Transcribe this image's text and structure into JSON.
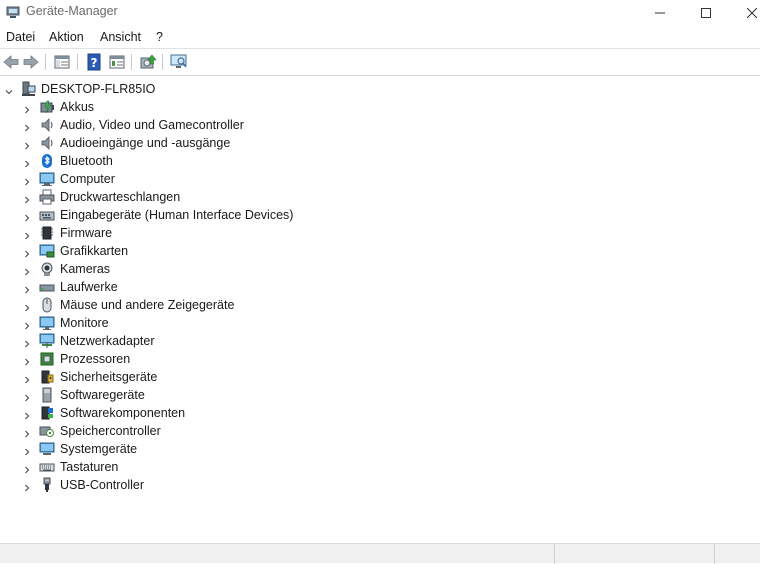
{
  "window": {
    "title": "Geräte-Manager"
  },
  "menu": {
    "items": [
      "Datei",
      "Aktion",
      "Ansicht",
      "?"
    ]
  },
  "tree": {
    "root_label": "DESKTOP-FLR85IO",
    "categories": [
      {
        "label": "Akkus",
        "icon": "battery-icon"
      },
      {
        "label": "Audio, Video und Gamecontroller",
        "icon": "speaker-icon"
      },
      {
        "label": "Audioeingänge und -ausgänge",
        "icon": "speaker-icon"
      },
      {
        "label": "Bluetooth",
        "icon": "bluetooth-icon"
      },
      {
        "label": "Computer",
        "icon": "computer-icon"
      },
      {
        "label": "Druckwarteschlangen",
        "icon": "printer-icon"
      },
      {
        "label": "Eingabegeräte (Human Interface Devices)",
        "icon": "hid-icon"
      },
      {
        "label": "Firmware",
        "icon": "firmware-icon"
      },
      {
        "label": "Grafikkarten",
        "icon": "display-adapter-icon"
      },
      {
        "label": "Kameras",
        "icon": "camera-icon"
      },
      {
        "label": "Laufwerke",
        "icon": "disk-drive-icon"
      },
      {
        "label": "Mäuse und andere Zeigegeräte",
        "icon": "mouse-icon"
      },
      {
        "label": "Monitore",
        "icon": "monitor-icon"
      },
      {
        "label": "Netzwerkadapter",
        "icon": "network-adapter-icon"
      },
      {
        "label": "Prozessoren",
        "icon": "processor-icon"
      },
      {
        "label": "Sicherheitsgeräte",
        "icon": "security-device-icon"
      },
      {
        "label": "Softwaregeräte",
        "icon": "software-device-icon"
      },
      {
        "label": "Softwarekomponenten",
        "icon": "software-component-icon"
      },
      {
        "label": "Speichercontroller",
        "icon": "storage-controller-icon"
      },
      {
        "label": "Systemgeräte",
        "icon": "system-device-icon"
      },
      {
        "label": "Tastaturen",
        "icon": "keyboard-icon"
      },
      {
        "label": "USB-Controller",
        "icon": "usb-icon"
      }
    ]
  }
}
